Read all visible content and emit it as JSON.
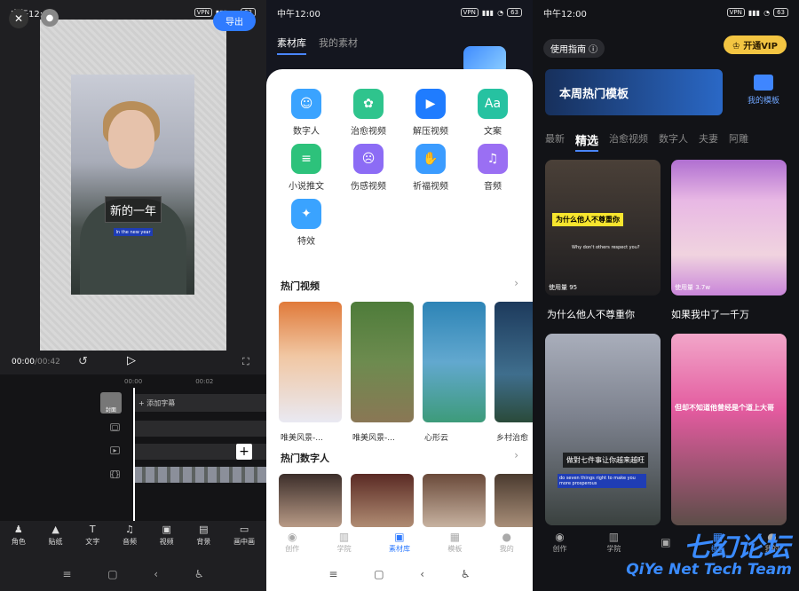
{
  "status": {
    "time": "中午12:00",
    "vpn": "VPN",
    "battery": "63"
  },
  "editor": {
    "export_label": "导出",
    "caption_main": "新的一年",
    "caption_sub": "In the new year",
    "time_current": "00:00",
    "time_total": "/00:42",
    "ruler": [
      "00:00",
      "00:02"
    ],
    "cover_label": "封面",
    "add_subtitle": "+ 添加字幕",
    "tools": [
      "角色",
      "贴纸",
      "文字",
      "音频",
      "视频",
      "背景",
      "画中画"
    ]
  },
  "library": {
    "tabs": [
      "素材库",
      "我的素材"
    ],
    "categories": [
      {
        "label": "数字人",
        "color": "#3aa3ff",
        "icon": "☺"
      },
      {
        "label": "治愈视频",
        "color": "#2fc48d",
        "icon": "✿"
      },
      {
        "label": "解压视频",
        "color": "#1f7cff",
        "icon": "▶"
      },
      {
        "label": "文案",
        "color": "#26c2a1",
        "icon": "Aa"
      },
      {
        "label": "小说推文",
        "color": "#2dc27b",
        "icon": "≡"
      },
      {
        "label": "伤感视频",
        "color": "#8c6cf5",
        "icon": "☹"
      },
      {
        "label": "祈福视频",
        "color": "#3b9cff",
        "icon": "✋"
      },
      {
        "label": "音频",
        "color": "#9a6ff3",
        "icon": "♫"
      },
      {
        "label": "特效",
        "color": "#3aa3ff",
        "icon": "✦"
      }
    ],
    "hot_videos_title": "热门视频",
    "hot_videos": [
      "唯美风景-...",
      "唯美风景-...",
      "心形云",
      "乡村治愈"
    ],
    "hot_digital_title": "热门数字人",
    "bottom_nav": [
      "创作",
      "学院",
      "素材库",
      "模板",
      "我的"
    ]
  },
  "templates": {
    "guide": "使用指南 ⓘ",
    "vip": "♔ 开通VIP",
    "banner": "本周热门模板",
    "my_templates": "我的模板",
    "categories": [
      "最新",
      "精选",
      "治愈视频",
      "数字人",
      "夫妻",
      "阿雕"
    ],
    "card1_caption": "为什么他人不尊重你",
    "card1_sub": "Why don't others respect you?",
    "card1_usage": "使用量 95",
    "card1_title": "为什么他人不尊重你",
    "card2_usage": "使用量 3.7w",
    "card2_title": "如果我中了一千万",
    "card3_caption": "做對七件事让你越来越旺",
    "card3_sub": "do seven things right to make you more prosperous",
    "card4_caption": "但却不知道他曾经是个道上大哥",
    "bottom_nav": [
      "创作",
      "学院",
      "",
      "模板",
      "我的"
    ],
    "watermark": "七幻论坛",
    "watermark_en": "QiYe Net Tech Team"
  }
}
